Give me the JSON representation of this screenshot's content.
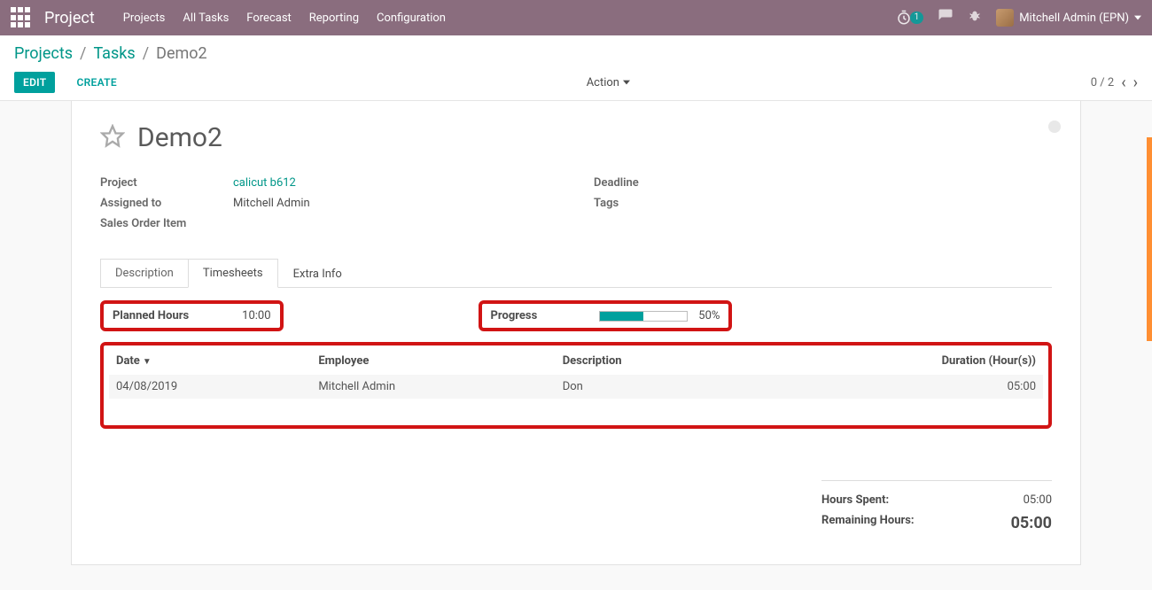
{
  "nav": {
    "brand": "Project",
    "items": [
      "Projects",
      "All Tasks",
      "Forecast",
      "Reporting",
      "Configuration"
    ],
    "timer_badge": "1",
    "user_name": "Mitchell Admin (EPN)"
  },
  "breadcrumb": {
    "a": "Projects",
    "b": "Tasks",
    "current": "Demo2"
  },
  "buttons": {
    "edit": "EDIT",
    "create": "CREATE",
    "action": "Action"
  },
  "pager": {
    "label": "0 / 2"
  },
  "task": {
    "title": "Demo2",
    "left": {
      "project_label": "Project",
      "project_value": "calicut b612",
      "assigned_label": "Assigned to",
      "assigned_value": "Mitchell Admin",
      "soi_label": "Sales Order Item",
      "soi_value": ""
    },
    "right": {
      "deadline_label": "Deadline",
      "deadline_value": "",
      "tags_label": "Tags",
      "tags_value": ""
    }
  },
  "tabs": {
    "desc": "Description",
    "ts": "Timesheets",
    "extra": "Extra Info"
  },
  "timesheets": {
    "planned_label": "Planned Hours",
    "planned_value": "10:00",
    "progress_label": "Progress",
    "progress_pct": 50,
    "progress_text": "50%",
    "cols": {
      "date": "Date",
      "employee": "Employee",
      "desc": "Description",
      "dur": "Duration (Hour(s))"
    },
    "rows": [
      {
        "date": "04/08/2019",
        "employee": "Mitchell Admin",
        "desc": "Don",
        "dur": "05:00"
      }
    ]
  },
  "totals": {
    "spent_label": "Hours Spent:",
    "spent_value": "05:00",
    "remain_label": "Remaining Hours:",
    "remain_value": "05:00"
  }
}
